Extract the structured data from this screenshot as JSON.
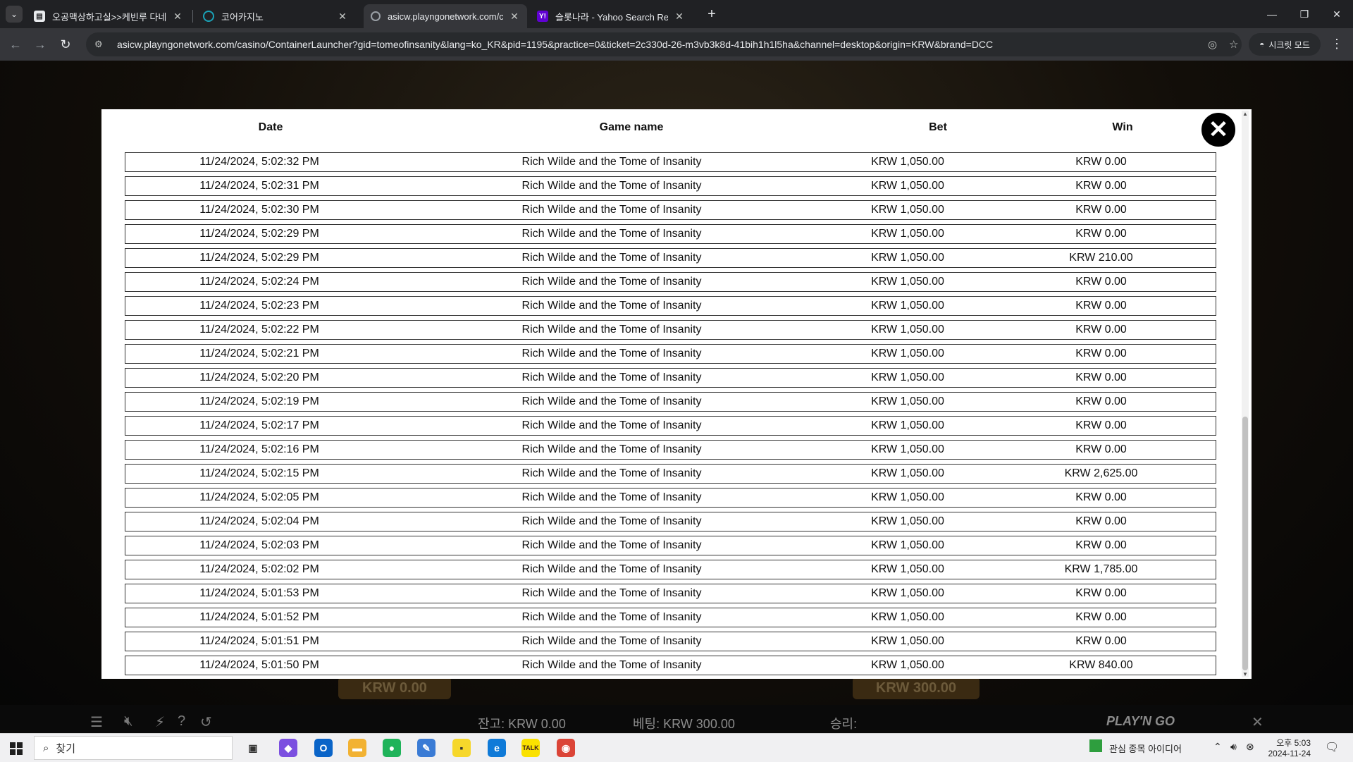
{
  "browser": {
    "tabs": [
      {
        "title": "오공맥상하고실>>케빈루 다네",
        "favicon_color": "#e8eaed",
        "active": false
      },
      {
        "title": "코어카지노",
        "favicon_color": "#1aa3b8",
        "active": false
      },
      {
        "title": "asicw.playngonetwork.com/ca",
        "favicon_color": "#9aa0a6",
        "active": true
      },
      {
        "title": "슬롯나라 - Yahoo Search Resul",
        "favicon_color": "#6001d2",
        "active": false
      }
    ],
    "url": "asicw.playngonetwork.com/casino/ContainerLauncher?gid=tomeofinsanity&lang=ko_KR&pid=1195&practice=0&ticket=2c330d-26-m3vb3k8d-41bih1h1l5ha&channel=desktop&origin=KRW&brand=DCC",
    "incognito_label": "시크릿 모드"
  },
  "history": {
    "columns": [
      "Date",
      "Game name",
      "Bet",
      "Win"
    ],
    "rows": [
      [
        "11/24/2024, 5:02:32 PM",
        "Rich Wilde and the Tome of Insanity",
        "KRW 1,050.00",
        "KRW 0.00"
      ],
      [
        "11/24/2024, 5:02:31 PM",
        "Rich Wilde and the Tome of Insanity",
        "KRW 1,050.00",
        "KRW 0.00"
      ],
      [
        "11/24/2024, 5:02:30 PM",
        "Rich Wilde and the Tome of Insanity",
        "KRW 1,050.00",
        "KRW 0.00"
      ],
      [
        "11/24/2024, 5:02:29 PM",
        "Rich Wilde and the Tome of Insanity",
        "KRW 1,050.00",
        "KRW 0.00"
      ],
      [
        "11/24/2024, 5:02:29 PM",
        "Rich Wilde and the Tome of Insanity",
        "KRW 1,050.00",
        "KRW 210.00"
      ],
      [
        "11/24/2024, 5:02:24 PM",
        "Rich Wilde and the Tome of Insanity",
        "KRW 1,050.00",
        "KRW 0.00"
      ],
      [
        "11/24/2024, 5:02:23 PM",
        "Rich Wilde and the Tome of Insanity",
        "KRW 1,050.00",
        "KRW 0.00"
      ],
      [
        "11/24/2024, 5:02:22 PM",
        "Rich Wilde and the Tome of Insanity",
        "KRW 1,050.00",
        "KRW 0.00"
      ],
      [
        "11/24/2024, 5:02:21 PM",
        "Rich Wilde and the Tome of Insanity",
        "KRW 1,050.00",
        "KRW 0.00"
      ],
      [
        "11/24/2024, 5:02:20 PM",
        "Rich Wilde and the Tome of Insanity",
        "KRW 1,050.00",
        "KRW 0.00"
      ],
      [
        "11/24/2024, 5:02:19 PM",
        "Rich Wilde and the Tome of Insanity",
        "KRW 1,050.00",
        "KRW 0.00"
      ],
      [
        "11/24/2024, 5:02:17 PM",
        "Rich Wilde and the Tome of Insanity",
        "KRW 1,050.00",
        "KRW 0.00"
      ],
      [
        "11/24/2024, 5:02:16 PM",
        "Rich Wilde and the Tome of Insanity",
        "KRW 1,050.00",
        "KRW 0.00"
      ],
      [
        "11/24/2024, 5:02:15 PM",
        "Rich Wilde and the Tome of Insanity",
        "KRW 1,050.00",
        "KRW 2,625.00"
      ],
      [
        "11/24/2024, 5:02:05 PM",
        "Rich Wilde and the Tome of Insanity",
        "KRW 1,050.00",
        "KRW 0.00"
      ],
      [
        "11/24/2024, 5:02:04 PM",
        "Rich Wilde and the Tome of Insanity",
        "KRW 1,050.00",
        "KRW 0.00"
      ],
      [
        "11/24/2024, 5:02:03 PM",
        "Rich Wilde and the Tome of Insanity",
        "KRW 1,050.00",
        "KRW 0.00"
      ],
      [
        "11/24/2024, 5:02:02 PM",
        "Rich Wilde and the Tome of Insanity",
        "KRW 1,050.00",
        "KRW 1,785.00"
      ],
      [
        "11/24/2024, 5:01:53 PM",
        "Rich Wilde and the Tome of Insanity",
        "KRW 1,050.00",
        "KRW 0.00"
      ],
      [
        "11/24/2024, 5:01:52 PM",
        "Rich Wilde and the Tome of Insanity",
        "KRW 1,050.00",
        "KRW 0.00"
      ],
      [
        "11/24/2024, 5:01:51 PM",
        "Rich Wilde and the Tome of Insanity",
        "KRW 1,050.00",
        "KRW 0.00"
      ],
      [
        "11/24/2024, 5:01:50 PM",
        "Rich Wilde and the Tome of Insanity",
        "KRW 1,050.00",
        "KRW 840.00"
      ]
    ]
  },
  "game_hud": {
    "balance": "잔고: KRW 0.00",
    "bet": "베팅: KRW 300.00",
    "win": "승리:",
    "left_amount": "KRW 0.00",
    "right_amount": "KRW 300.00",
    "brand": "PLAY'N GO"
  },
  "taskbar": {
    "search_label": "찾기",
    "widget_label": "관심 종목 아이디어",
    "time": "오후 5:03",
    "date": "2024-11-24"
  }
}
